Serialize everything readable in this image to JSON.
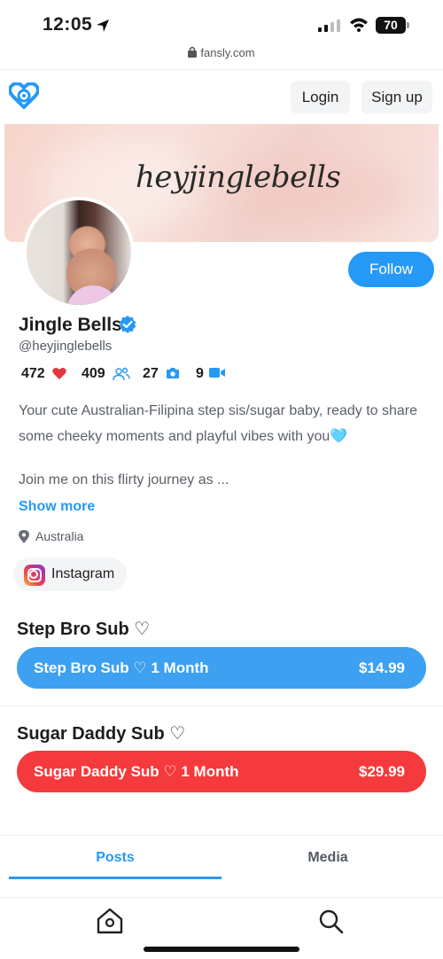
{
  "status_bar": {
    "time": "12:05",
    "battery": "70",
    "url": "fansly.com"
  },
  "header": {
    "login_label": "Login",
    "signup_label": "Sign up"
  },
  "banner": {
    "text": "heyjinglebells"
  },
  "profile": {
    "follow_label": "Follow",
    "display_name": "Jingle Bells",
    "handle": "@heyjinglebells",
    "stats": {
      "likes": "472",
      "followers": "409",
      "photos": "27",
      "videos": "9"
    },
    "bio_line1": "Your cute Australian-Filipina step sis/sugar baby, ready to share some cheeky moments and playful vibes with you🩵",
    "bio_line2": "Join me on this flirty journey as ...",
    "show_more_label": "Show more",
    "location": "Australia",
    "social": {
      "instagram_label": "Instagram"
    }
  },
  "subscriptions": [
    {
      "title": "Step Bro Sub ♡",
      "button_label": "Step Bro Sub ♡ 1 Month",
      "price": "$14.99",
      "color": "#3da0f0"
    },
    {
      "title": "Sugar Daddy Sub ♡",
      "button_label": "Sugar Daddy Sub ♡ 1 Month",
      "price": "$29.99",
      "color": "#f43a3c"
    }
  ],
  "tabs": {
    "posts_label": "Posts",
    "media_label": "Media",
    "active": "Posts"
  },
  "colors": {
    "accent": "#2699f6",
    "heart": "#e5343d"
  },
  "icons": {
    "nav_left": "home-icon",
    "nav_right": "search-icon"
  }
}
